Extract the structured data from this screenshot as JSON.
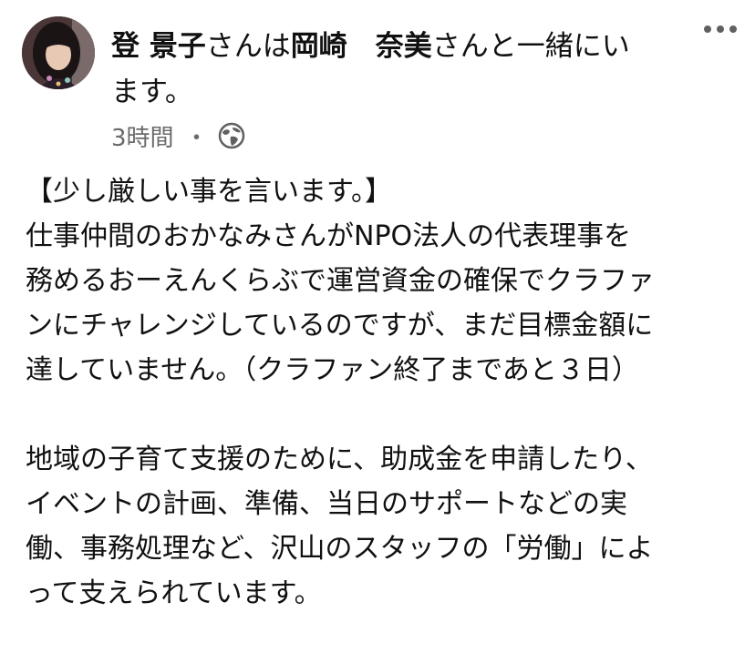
{
  "post": {
    "author": "登 景子",
    "connector": "さんは",
    "tagged": "岡崎　奈美",
    "suffix_line1": "さんと一緒にい",
    "suffix_line2": "ます。",
    "time": "3時間",
    "separator": "・",
    "privacy_icon": "globe-icon",
    "more_icon": "more-options-icon",
    "body_paragraph1": [
      "【少し厳しい事を言います。】",
      "仕事仲間のおかなみさんがNPO法人の代表理事を",
      "務めるおーえんくらぶで運営資金の確保でクラファ",
      "ンにチャレンジしているのですが、まだ目標金額に",
      "達していません。（クラファン終了まであと３日）"
    ],
    "body_paragraph2": [
      "地域の子育て支援のために、助成金を申請したり、",
      "イベントの計画、準備、当日のサポートなどの実",
      "働、事務処理など、沢山のスタッフの「労働」によ",
      "って支えられています。"
    ]
  }
}
